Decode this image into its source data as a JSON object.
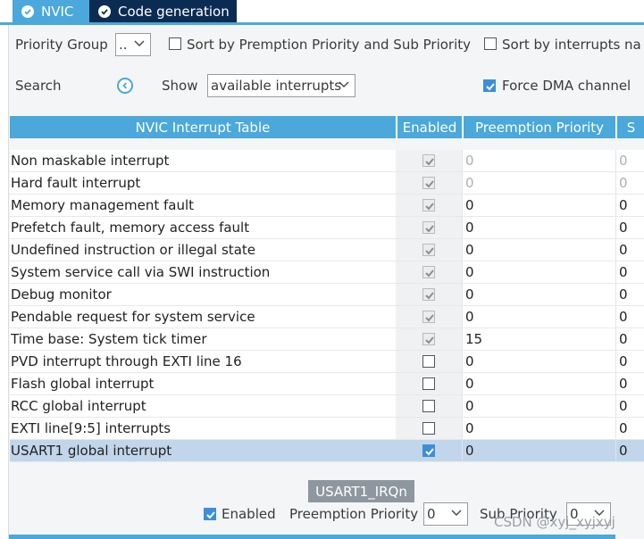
{
  "tabs": [
    {
      "label": "NVIC",
      "icon": "check-circle-icon",
      "active": true
    },
    {
      "label": "Code generation",
      "icon": "check-circle-icon",
      "active": false
    }
  ],
  "toolbar": {
    "priority_group_label": "Priority Group",
    "priority_group_value": "..",
    "sort_preemption_label": "Sort by Premption Priority and Sub Priority",
    "sort_preemption_checked": false,
    "sort_interrupts_label": "Sort by interrupts na",
    "sort_interrupts_checked": false,
    "search_label": "Search",
    "show_label": "Show",
    "show_value": "available interrupts",
    "force_dma_label": "Force DMA channel",
    "force_dma_checked": true
  },
  "table": {
    "headers": {
      "name": "NVIC Interrupt Table",
      "enabled": "Enabled",
      "preemption": "Preemption Priority",
      "sub": "S"
    },
    "rows": [
      {
        "name": "Non maskable interrupt",
        "enabled": "locked",
        "preemption": "0",
        "sub": "0",
        "dim": true
      },
      {
        "name": "Hard fault interrupt",
        "enabled": "locked",
        "preemption": "0",
        "sub": "0",
        "dim": true
      },
      {
        "name": "Memory management fault",
        "enabled": "locked",
        "preemption": "0",
        "sub": "0",
        "dim": false
      },
      {
        "name": "Prefetch fault, memory access fault",
        "enabled": "locked",
        "preemption": "0",
        "sub": "0",
        "dim": false
      },
      {
        "name": "Undefined instruction or illegal state",
        "enabled": "locked",
        "preemption": "0",
        "sub": "0",
        "dim": false
      },
      {
        "name": "System service call via SWI instruction",
        "enabled": "locked",
        "preemption": "0",
        "sub": "0",
        "dim": false
      },
      {
        "name": "Debug monitor",
        "enabled": "locked",
        "preemption": "0",
        "sub": "0",
        "dim": false
      },
      {
        "name": "Pendable request for system service",
        "enabled": "locked",
        "preemption": "0",
        "sub": "0",
        "dim": false
      },
      {
        "name": "Time base: System tick timer",
        "enabled": "locked",
        "preemption": "15",
        "sub": "0",
        "dim": false
      },
      {
        "name": "PVD interrupt through EXTI line 16",
        "enabled": "off",
        "preemption": "0",
        "sub": "0",
        "dim": false
      },
      {
        "name": "Flash global interrupt",
        "enabled": "off",
        "preemption": "0",
        "sub": "0",
        "dim": false
      },
      {
        "name": "RCC global interrupt",
        "enabled": "off",
        "preemption": "0",
        "sub": "0",
        "dim": false
      },
      {
        "name": "EXTI line[9:5] interrupts",
        "enabled": "off",
        "preemption": "0",
        "sub": "0",
        "dim": false
      },
      {
        "name": "USART1 global interrupt",
        "enabled": "on",
        "preemption": "0",
        "sub": "0",
        "dim": false,
        "selected": true
      }
    ]
  },
  "config": {
    "title": "USART1_IRQn",
    "enabled_label": "Enabled",
    "enabled_checked": true,
    "preemption_label": "Preemption Priority",
    "preemption_value": "0",
    "sub_label": "Sub Priority",
    "sub_value": "0"
  },
  "watermark": "CSDN @xyj_xyjxyj",
  "colors": {
    "accent": "#4aa8db",
    "dark_tab": "#0b2c52",
    "selected_row": "#c1d6eb",
    "checkbox_blue": "#3b8fd9"
  }
}
